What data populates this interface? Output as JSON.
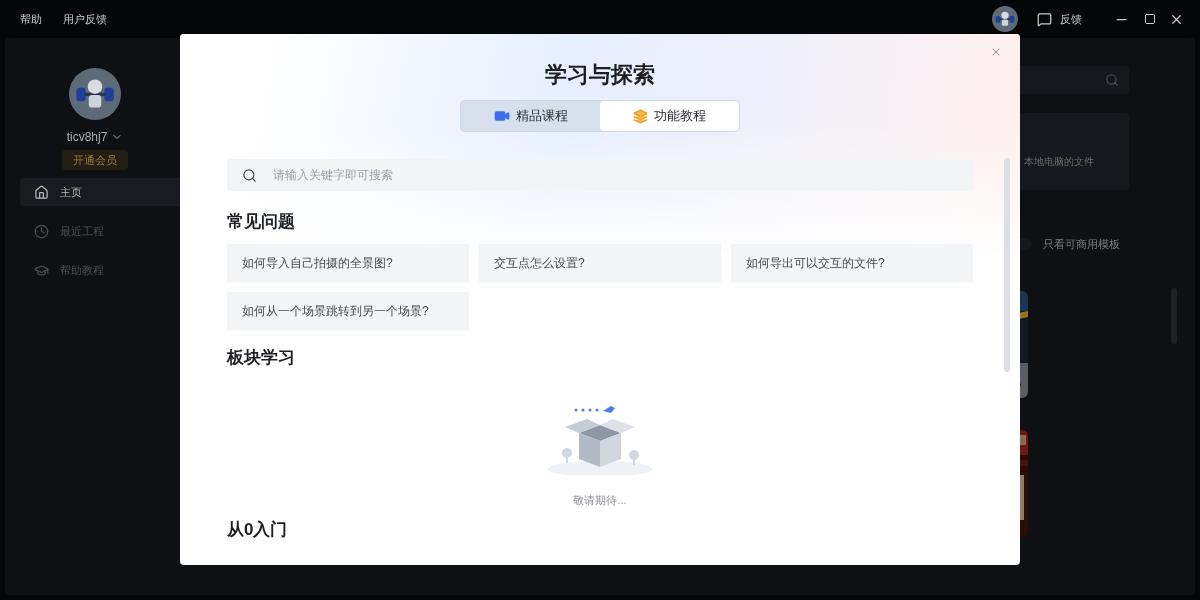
{
  "top_bar": {
    "menu": [
      "帮助",
      "用户反馈"
    ],
    "feedback": "反馈"
  },
  "sidebar": {
    "username": "ticv8hj7",
    "vip_button": "开通会员",
    "items": [
      {
        "label": "主页",
        "selected": true
      },
      {
        "label": "最近工程",
        "selected": false
      },
      {
        "label": "帮助教程",
        "selected": false
      }
    ]
  },
  "home": {
    "card_text": "本地电脑的文件",
    "toggle": {
      "label": "只看可商用模板",
      "on": false
    }
  },
  "dialog": {
    "title": "学习与探索",
    "tabs": [
      {
        "label": "精品课程",
        "selected": false
      },
      {
        "label": "功能教程",
        "selected": true
      }
    ],
    "search": {
      "placeholder": "请输入关键字即可搜索"
    },
    "sections": [
      {
        "kind": "questions",
        "heading": "常见问题",
        "items": [
          "如何导入自己拍摄的全景图?",
          "交互点怎么设置?",
          "如何导出可以交互的文件?",
          "如何从一个场景跳转到另一个场景?"
        ]
      },
      {
        "kind": "empty",
        "heading": "板块学习",
        "empty_text": "敬请期待..."
      },
      {
        "kind": "plain",
        "heading": "从0入门"
      }
    ]
  }
}
